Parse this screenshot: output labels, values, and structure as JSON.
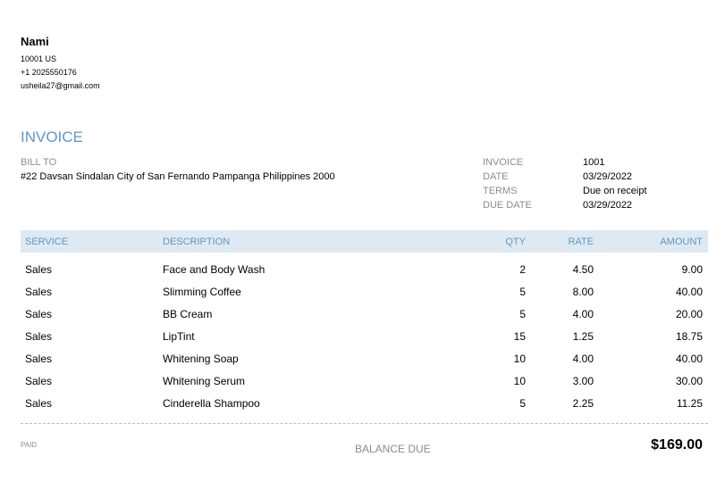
{
  "company": {
    "name": "Nami",
    "address": "10001 US",
    "phone": "+1 2025550176",
    "email": "usheila27@gmail.com"
  },
  "title": "INVOICE",
  "bill_to": {
    "label": "BILL TO",
    "address": "#22 Davsan Sindalan City of San Fernando Pampanga Philippines 2000"
  },
  "meta": [
    {
      "label": "INVOICE",
      "value": "1001"
    },
    {
      "label": "DATE",
      "value": "03/29/2022"
    },
    {
      "label": "TERMS",
      "value": "Due on receipt"
    },
    {
      "label": "DUE DATE",
      "value": "03/29/2022"
    }
  ],
  "columns": {
    "service": "SERVICE",
    "description": "DESCRIPTION",
    "qty": "QTY",
    "rate": "RATE",
    "amount": "AMOUNT"
  },
  "items": [
    {
      "service": "Sales",
      "description": "Face and Body Wash",
      "qty": "2",
      "rate": "4.50",
      "amount": "9.00"
    },
    {
      "service": "Sales",
      "description": "Slimming Coffee",
      "qty": "5",
      "rate": "8.00",
      "amount": "40.00"
    },
    {
      "service": "Sales",
      "description": "BB Cream",
      "qty": "5",
      "rate": "4.00",
      "amount": "20.00"
    },
    {
      "service": "Sales",
      "description": "LipTint",
      "qty": "15",
      "rate": "1.25",
      "amount": "18.75"
    },
    {
      "service": "Sales",
      "description": "Whitening Soap",
      "qty": "10",
      "rate": "4.00",
      "amount": "40.00"
    },
    {
      "service": "Sales",
      "description": "Whitening Serum",
      "qty": "10",
      "rate": "3.00",
      "amount": "30.00"
    },
    {
      "service": "Sales",
      "description": "Cinderella Shampoo",
      "qty": "5",
      "rate": "2.25",
      "amount": "11.25"
    }
  ],
  "footer": {
    "paid": "PAID",
    "balance_label": "BALANCE DUE",
    "balance": "$169.00"
  }
}
